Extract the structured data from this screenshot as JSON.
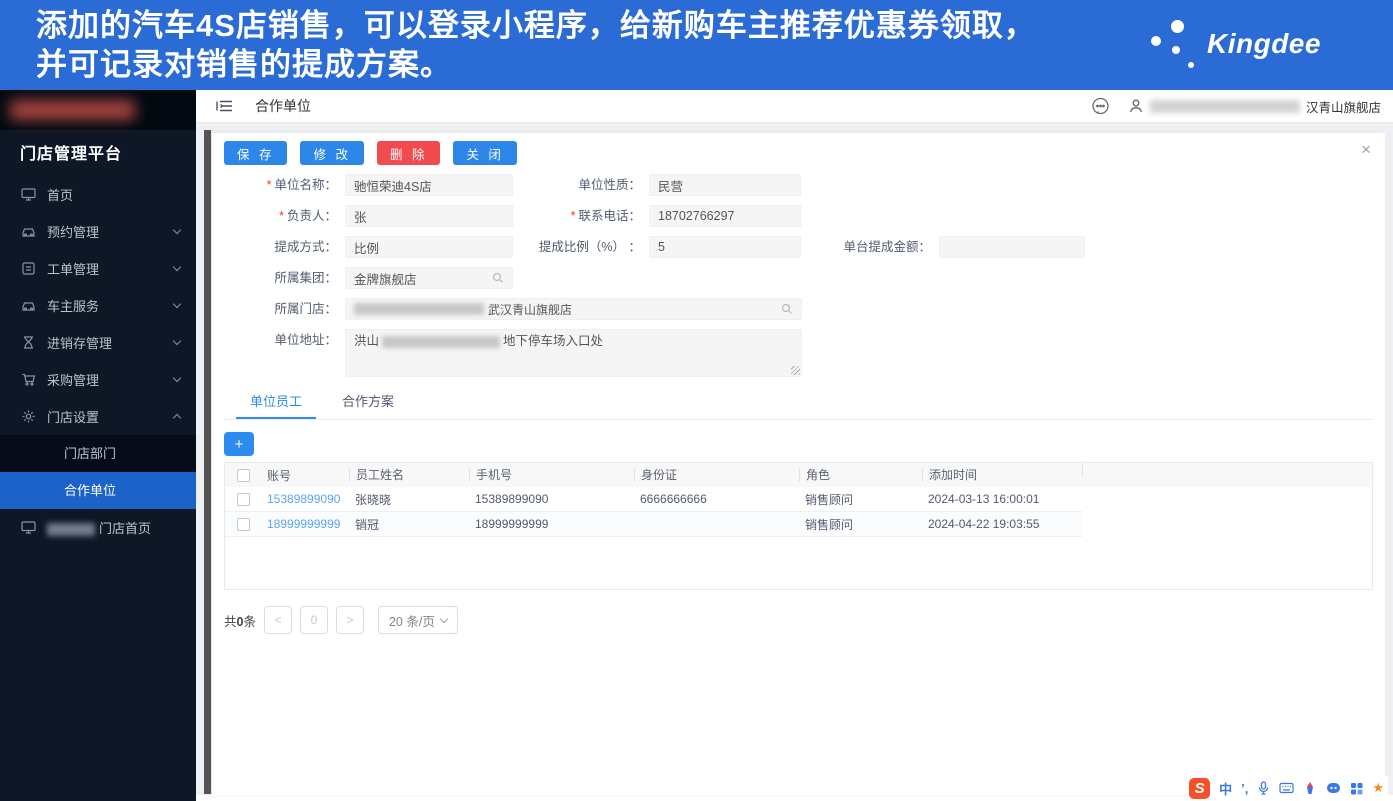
{
  "banner": {
    "line1": "添加的汽车4S店销售，可以登录小程序，给新购车主推荐优惠券领取，",
    "line2": "并可记录对销售的提成方案。",
    "brand": "Kingdee"
  },
  "sidebar": {
    "title": "门店管理平台",
    "items": [
      {
        "label": "首页"
      },
      {
        "label": "预约管理"
      },
      {
        "label": "工单管理"
      },
      {
        "label": "车主服务"
      },
      {
        "label": "进销存管理"
      },
      {
        "label": "采购管理"
      },
      {
        "label": "门店设置"
      }
    ],
    "submenu": [
      {
        "label": "门店部门"
      },
      {
        "label": "合作单位"
      }
    ],
    "bottom_item_suffix": "门店首页"
  },
  "header": {
    "title": "合作单位",
    "user_store_suffix": "汉青山旗舰店",
    "close": "×"
  },
  "toolbar": {
    "save": "保 存",
    "modify": "修 改",
    "delete": "删 除",
    "close": "关 闭"
  },
  "form": {
    "unit_name": {
      "label": "单位名称：",
      "value": "驰恒荣迪4S店"
    },
    "unit_nature": {
      "label": "单位性质：",
      "value": "民营"
    },
    "principal": {
      "label": "负责人：",
      "value": "张"
    },
    "contact_phone": {
      "label": "联系电话：",
      "value": "18702766297"
    },
    "commission_mode": {
      "label": "提成方式：",
      "value": "比例"
    },
    "commission_ratio": {
      "label": "提成比例（%） ：",
      "value": "5"
    },
    "per_unit_amount": {
      "label": "单台提成金额：",
      "value": ""
    },
    "group": {
      "label": "所属集团：",
      "value": "金牌旗舰店"
    },
    "store": {
      "label": "所属门店：",
      "value_suffix": "武汉青山旗舰店"
    },
    "address": {
      "label": "单位地址：",
      "value_prefix": "洪山",
      "value_suffix": "地下停车场入口处"
    }
  },
  "tabs": [
    {
      "label": "单位员工"
    },
    {
      "label": "合作方案"
    }
  ],
  "add_button": "+",
  "table": {
    "headers": [
      "账号",
      "员工姓名",
      "手机号",
      "身份证",
      "角色",
      "添加时间"
    ],
    "rows": [
      {
        "account": "15389899090",
        "name": "张晓晓",
        "phone": "15389899090",
        "id_card": "6666666666",
        "role": "销售顾问",
        "added_time": "2024-03-13 16:00:01"
      },
      {
        "account": "18999999999",
        "name": "销冠",
        "phone": "18999999999",
        "id_card": "",
        "role": "销售顾问",
        "added_time": "2024-04-22 19:03:55"
      }
    ]
  },
  "pagination": {
    "total_prefix": "共",
    "total_count": "0",
    "total_suffix": "条",
    "prev": "<",
    "page": "0",
    "next": ">",
    "page_size": "20 条/页"
  },
  "ime": {
    "logo": "S",
    "mode": "中",
    "punct": "’,",
    "star": "★"
  },
  "colors": {
    "banner_blue": "#2a6bd5",
    "button_blue": "#2d87e8",
    "delete_red": "#f14b50",
    "sidebar_active_blue": "#1b62c9",
    "tab_active_blue": "#2d8cf0",
    "link_blue": "#5aa5f7"
  }
}
